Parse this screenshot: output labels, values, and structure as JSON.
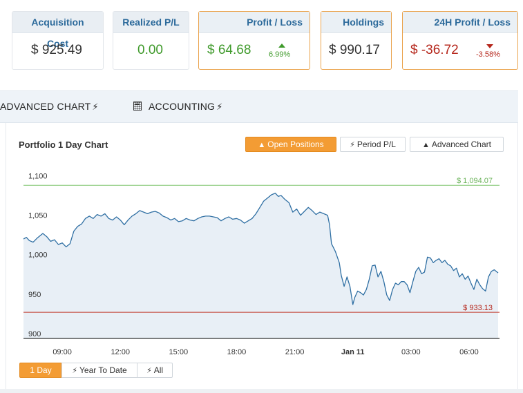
{
  "cards": [
    {
      "id": "acquisition",
      "label": "Acquisition Cost",
      "value": "$ 925.49"
    },
    {
      "id": "realized",
      "label": "Realized P/L",
      "value": "0.00"
    },
    {
      "id": "profit",
      "label": "Profit / Loss",
      "value": "$ 64.68",
      "pct": "6.99%"
    },
    {
      "id": "holdings",
      "label": "Holdings",
      "value": "$ 990.17"
    },
    {
      "id": "h24",
      "label": "24H Profit / Loss",
      "value": "$ -36.72",
      "pct": "-3.58%"
    }
  ],
  "tabs": {
    "advanced": "ADVANCED CHART",
    "accounting": "ACCOUNTING"
  },
  "chart_panel": {
    "title": "Portfolio 1 Day Chart",
    "buttons": {
      "open_positions": "Open Positions",
      "period_pl": "Period P/L",
      "advanced_chart": "Advanced Chart"
    },
    "range_buttons": {
      "day": "1 Day",
      "ytd": "Year To Date",
      "all": "All"
    }
  },
  "chart_data": {
    "type": "area",
    "title": "",
    "xlabel": "",
    "ylabel": "",
    "ylim": [
      900,
      1110
    ],
    "y_ticks": [
      "1,100",
      "1,050",
      "1,000",
      "950",
      "900"
    ],
    "y_tick_values": [
      1100,
      1050,
      1000,
      950,
      900
    ],
    "x_ticks": [
      "09:00",
      "12:00",
      "15:00",
      "18:00",
      "21:00",
      "Jan 11",
      "03:00",
      "06:00"
    ],
    "x_tick_hours": [
      9,
      12,
      15,
      18,
      21,
      24,
      27,
      30
    ],
    "xlim_hours": [
      7.0,
      31.5
    ],
    "max_line": {
      "label": "$ 1,094.07",
      "value": 1094.07,
      "color": "#7cc46a"
    },
    "min_line": {
      "label": "$ 933.13",
      "value": 933.13,
      "color": "#c0392b"
    },
    "line_color": "#2f6fa3",
    "fill_color": "#e8eff6",
    "series": [
      {
        "values": [
          [
            7.0,
            1026
          ],
          [
            7.15,
            1028
          ],
          [
            7.3,
            1024
          ],
          [
            7.5,
            1022
          ],
          [
            7.7,
            1027
          ],
          [
            8.0,
            1033
          ],
          [
            8.2,
            1029
          ],
          [
            8.4,
            1023
          ],
          [
            8.6,
            1025
          ],
          [
            8.8,
            1019
          ],
          [
            9.0,
            1021
          ],
          [
            9.2,
            1016
          ],
          [
            9.4,
            1020
          ],
          [
            9.6,
            1036
          ],
          [
            9.8,
            1042
          ],
          [
            10.0,
            1045
          ],
          [
            10.2,
            1052
          ],
          [
            10.4,
            1055
          ],
          [
            10.6,
            1052
          ],
          [
            10.8,
            1057
          ],
          [
            11.0,
            1055
          ],
          [
            11.2,
            1058
          ],
          [
            11.4,
            1052
          ],
          [
            11.6,
            1050
          ],
          [
            11.8,
            1054
          ],
          [
            12.0,
            1050
          ],
          [
            12.2,
            1044
          ],
          [
            12.4,
            1050
          ],
          [
            12.6,
            1055
          ],
          [
            12.8,
            1058
          ],
          [
            13.0,
            1062
          ],
          [
            13.2,
            1060
          ],
          [
            13.4,
            1058
          ],
          [
            13.6,
            1060
          ],
          [
            13.8,
            1061
          ],
          [
            14.0,
            1059
          ],
          [
            14.2,
            1055
          ],
          [
            14.4,
            1053
          ],
          [
            14.6,
            1050
          ],
          [
            14.8,
            1052
          ],
          [
            15.0,
            1048
          ],
          [
            15.2,
            1049
          ],
          [
            15.4,
            1052
          ],
          [
            15.6,
            1050
          ],
          [
            15.8,
            1049
          ],
          [
            16.0,
            1052
          ],
          [
            16.2,
            1054
          ],
          [
            16.4,
            1055
          ],
          [
            16.6,
            1055
          ],
          [
            16.8,
            1054
          ],
          [
            17.0,
            1053
          ],
          [
            17.2,
            1049
          ],
          [
            17.4,
            1052
          ],
          [
            17.6,
            1054
          ],
          [
            17.8,
            1051
          ],
          [
            18.0,
            1052
          ],
          [
            18.2,
            1050
          ],
          [
            18.4,
            1046
          ],
          [
            18.6,
            1049
          ],
          [
            18.8,
            1052
          ],
          [
            19.0,
            1058
          ],
          [
            19.2,
            1066
          ],
          [
            19.4,
            1074
          ],
          [
            19.6,
            1078
          ],
          [
            19.8,
            1082
          ],
          [
            20.0,
            1084
          ],
          [
            20.15,
            1080
          ],
          [
            20.3,
            1081
          ],
          [
            20.5,
            1076
          ],
          [
            20.7,
            1072
          ],
          [
            20.9,
            1060
          ],
          [
            21.1,
            1064
          ],
          [
            21.3,
            1056
          ],
          [
            21.5,
            1061
          ],
          [
            21.7,
            1066
          ],
          [
            21.9,
            1062
          ],
          [
            22.1,
            1057
          ],
          [
            22.3,
            1060
          ],
          [
            22.5,
            1058
          ],
          [
            22.7,
            1056
          ],
          [
            22.8,
            1044
          ],
          [
            22.9,
            1020
          ],
          [
            23.0,
            1015
          ],
          [
            23.1,
            1010
          ],
          [
            23.2,
            1003
          ],
          [
            23.3,
            996
          ],
          [
            23.4,
            980
          ],
          [
            23.55,
            966
          ],
          [
            23.7,
            978
          ],
          [
            23.85,
            966
          ],
          [
            24.0,
            943
          ],
          [
            24.1,
            952
          ],
          [
            24.25,
            960
          ],
          [
            24.4,
            958
          ],
          [
            24.55,
            955
          ],
          [
            24.7,
            962
          ],
          [
            24.85,
            975
          ],
          [
            25.0,
            992
          ],
          [
            25.15,
            993
          ],
          [
            25.3,
            978
          ],
          [
            25.45,
            985
          ],
          [
            25.6,
            972
          ],
          [
            25.75,
            955
          ],
          [
            25.9,
            948
          ],
          [
            26.05,
            962
          ],
          [
            26.2,
            970
          ],
          [
            26.35,
            968
          ],
          [
            26.5,
            972
          ],
          [
            26.65,
            972
          ],
          [
            26.8,
            968
          ],
          [
            26.95,
            958
          ],
          [
            27.1,
            972
          ],
          [
            27.25,
            985
          ],
          [
            27.4,
            990
          ],
          [
            27.55,
            982
          ],
          [
            27.7,
            984
          ],
          [
            27.85,
            1003
          ],
          [
            28.0,
            1002
          ],
          [
            28.15,
            996
          ],
          [
            28.3,
            999
          ],
          [
            28.45,
            1001
          ],
          [
            28.6,
            996
          ],
          [
            28.75,
            999
          ],
          [
            28.9,
            994
          ],
          [
            29.05,
            992
          ],
          [
            29.2,
            986
          ],
          [
            29.35,
            989
          ],
          [
            29.5,
            978
          ],
          [
            29.65,
            982
          ],
          [
            29.8,
            975
          ],
          [
            29.95,
            979
          ],
          [
            30.1,
            970
          ],
          [
            30.25,
            962
          ],
          [
            30.4,
            975
          ],
          [
            30.55,
            968
          ],
          [
            30.7,
            963
          ],
          [
            30.85,
            960
          ],
          [
            31.0,
            978
          ],
          [
            31.15,
            985
          ],
          [
            31.3,
            987
          ],
          [
            31.5,
            983
          ]
        ]
      }
    ]
  }
}
